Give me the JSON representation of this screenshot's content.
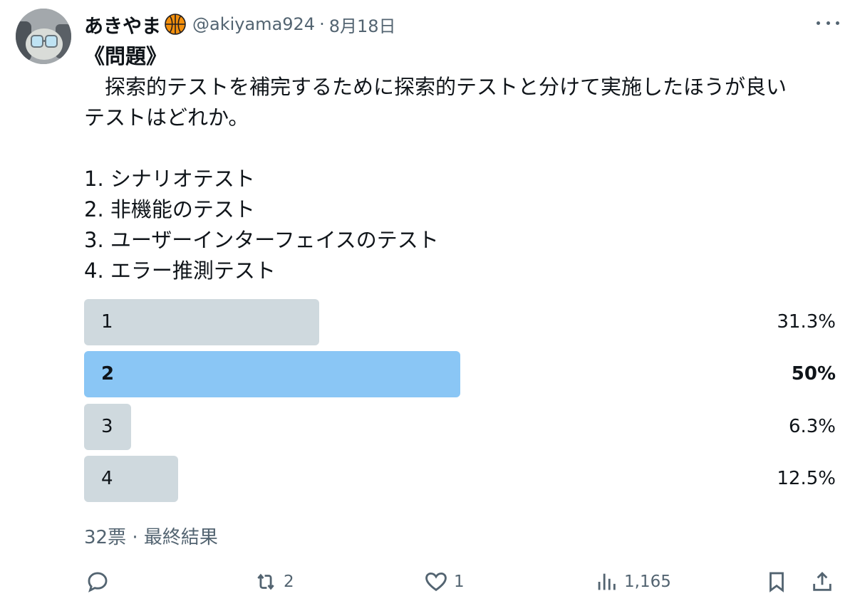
{
  "tweet": {
    "display_name": "あきやま",
    "handle": "@akiyama924",
    "separator": "·",
    "date": "8月18日",
    "title": "《問題》",
    "question_line1": "　探索的テストを補完するために探索的テストと分けて実施したほうが良い",
    "question_line2": "テストはどれか。",
    "options": [
      "1. シナリオテスト",
      "2. 非機能のテスト",
      "3. ユーザーインターフェイスのテスト",
      "4. エラー推測テスト"
    ]
  },
  "poll": {
    "choices": [
      {
        "label": "1",
        "percent_text": "31.3%",
        "percent": 31.3,
        "winner": false
      },
      {
        "label": "2",
        "percent_text": "50%",
        "percent": 50,
        "winner": true
      },
      {
        "label": "3",
        "percent_text": "6.3%",
        "percent": 6.3,
        "winner": false
      },
      {
        "label": "4",
        "percent_text": "12.5%",
        "percent": 12.5,
        "winner": false
      }
    ],
    "meta": "32票 · 最終結果"
  },
  "actions": {
    "reply": {
      "icon": "reply-icon",
      "count": ""
    },
    "retweet": {
      "icon": "retweet-icon",
      "count": "2"
    },
    "like": {
      "icon": "heart-icon",
      "count": "1"
    },
    "views": {
      "icon": "views-icon",
      "count": "1,165"
    },
    "bookmark": {
      "icon": "bookmark-icon"
    },
    "share": {
      "icon": "share-icon"
    }
  },
  "colors": {
    "winner_bar": "#8ac6f5",
    "bar": "#cfd9de",
    "secondary_text": "#536471"
  }
}
